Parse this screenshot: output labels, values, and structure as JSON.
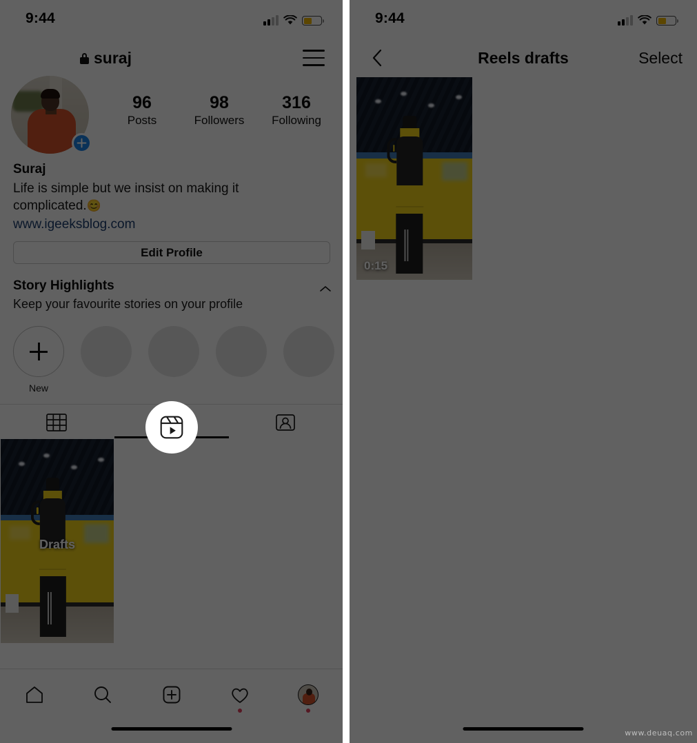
{
  "meta": {
    "watermark": "www.deuaq.com"
  },
  "colors": {
    "scrim": "#000000",
    "accent_blue": "#1b83e8",
    "badge_red": "#e0405e",
    "battery_yellow": "#f2b705",
    "link_blue": "#1c3e70",
    "bottle_yellow": "#f2d31a"
  },
  "left_panel": {
    "status_bar": {
      "time": "9:44",
      "signal_icon": "cellular-bars-icon",
      "wifi_icon": "wifi-icon",
      "battery_icon": "battery-low-power-icon"
    },
    "header": {
      "lock_icon": "lock-icon",
      "username": "suraj",
      "menu_icon": "hamburger-menu-icon"
    },
    "profile": {
      "avatar": "profile-avatar",
      "add_story_icon": "plus-badge-icon",
      "stats": [
        {
          "value": "96",
          "label": "Posts"
        },
        {
          "value": "98",
          "label": "Followers"
        },
        {
          "value": "316",
          "label": "Following"
        }
      ],
      "display_name": "Suraj",
      "bio_line1": "Life is simple but we insist on making it",
      "bio_line2": "complicated.",
      "bio_emoji": "😊",
      "website": "www.igeeksblog.com",
      "edit_profile_label": "Edit Profile"
    },
    "story_highlights": {
      "title": "Story Highlights",
      "subtitle": "Keep your favourite stories on your profile",
      "collapse_icon": "chevron-up-icon",
      "new_label": "New",
      "new_icon": "plus-icon",
      "placeholder_count": 4
    },
    "tabs": [
      {
        "id": "grid",
        "icon": "grid-icon",
        "active": false
      },
      {
        "id": "reels",
        "icon": "reels-icon",
        "active": true
      },
      {
        "id": "tagged",
        "icon": "tagged-icon",
        "active": false
      }
    ],
    "drafts_tile": {
      "label": "Drafts",
      "thumbnail": "reel-draft-thumbnail-water-bottle"
    },
    "bottom_nav": [
      {
        "id": "home",
        "icon": "home-icon",
        "badge": false
      },
      {
        "id": "search",
        "icon": "search-icon",
        "badge": false
      },
      {
        "id": "create",
        "icon": "plus-square-icon",
        "badge": false
      },
      {
        "id": "activity",
        "icon": "heart-icon",
        "badge": true
      },
      {
        "id": "profile",
        "icon": "profile-avatar-icon",
        "badge": true
      }
    ]
  },
  "right_panel": {
    "status_bar": {
      "time": "9:44",
      "signal_icon": "cellular-bars-icon",
      "wifi_icon": "wifi-icon",
      "battery_icon": "battery-low-power-icon"
    },
    "header": {
      "back_icon": "chevron-left-icon",
      "title": "Reels drafts",
      "select_label": "Select"
    },
    "drafts": [
      {
        "duration": "0:15",
        "thumbnail": "reel-draft-thumbnail-water-bottle"
      }
    ]
  }
}
